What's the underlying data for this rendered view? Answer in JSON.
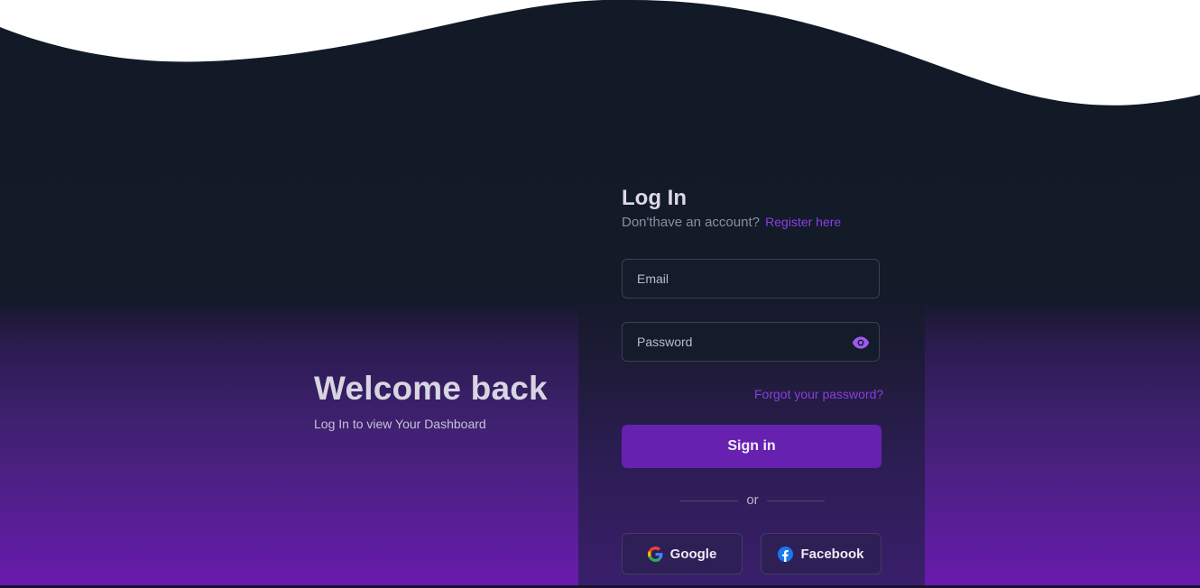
{
  "welcome": {
    "heading": "Welcome back",
    "subheading": "Log In to view Your Dashboard"
  },
  "login": {
    "title": "Log In",
    "no_account_text": "Don'thave an account?",
    "register_link": "Register here",
    "email_placeholder": "Email",
    "password_placeholder": "Password",
    "forgot_password": "Forgot your password?",
    "signin_label": "Sign in",
    "divider_text": "or",
    "google_label": "Google",
    "facebook_label": "Facebook"
  },
  "colors": {
    "accent": "#6721b1",
    "link": "#8a3ee0",
    "background": "#121a27"
  },
  "icons": [
    "eye-icon",
    "google-icon",
    "facebook-icon"
  ]
}
